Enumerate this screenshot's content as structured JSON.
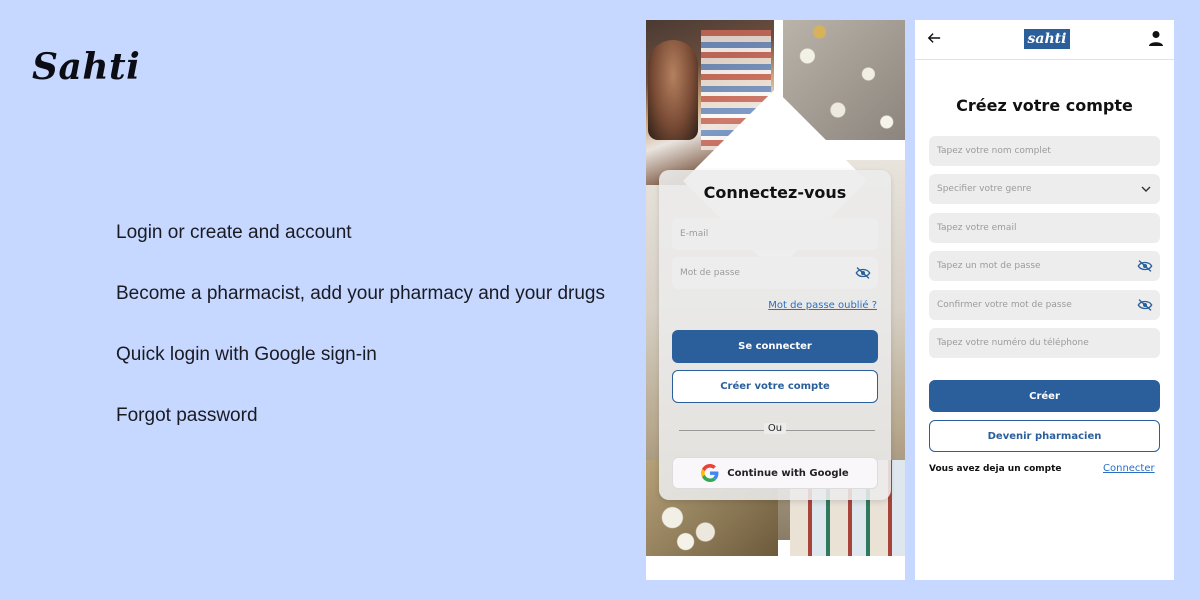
{
  "brand": "Sahti",
  "features": [
    "Login or create and account",
    "Become a pharmacist, add your pharmacy and your drugs",
    "Quick login with Google sign-in",
    "Forgot password"
  ],
  "login": {
    "title": "Connectez-vous",
    "email_placeholder": "E-mail",
    "password_placeholder": "Mot de passe",
    "forgot_link": "Mot de passe oublié ?",
    "login_button": "Se connecter",
    "create_button": "Créer votre compte",
    "separator": "Ou",
    "google_button": "Continue with Google"
  },
  "register": {
    "logo": "sahti",
    "title": "Créez votre compte",
    "fields": [
      "Tapez votre nom complet",
      "Specifier votre genre",
      "Tapez votre email",
      "Tapez un mot de passe",
      "Confirmer votre mot de passe",
      "Tapez votre numéro du téléphone"
    ],
    "create_button": "Créer",
    "pharmacist_button": "Devenir pharmacien",
    "already_text": "Vous avez deja un compte",
    "connect_link": "Connecter"
  },
  "colors": {
    "background": "#c6d8ff",
    "primary": "#2a5f9c",
    "link": "#2a6fc4"
  }
}
